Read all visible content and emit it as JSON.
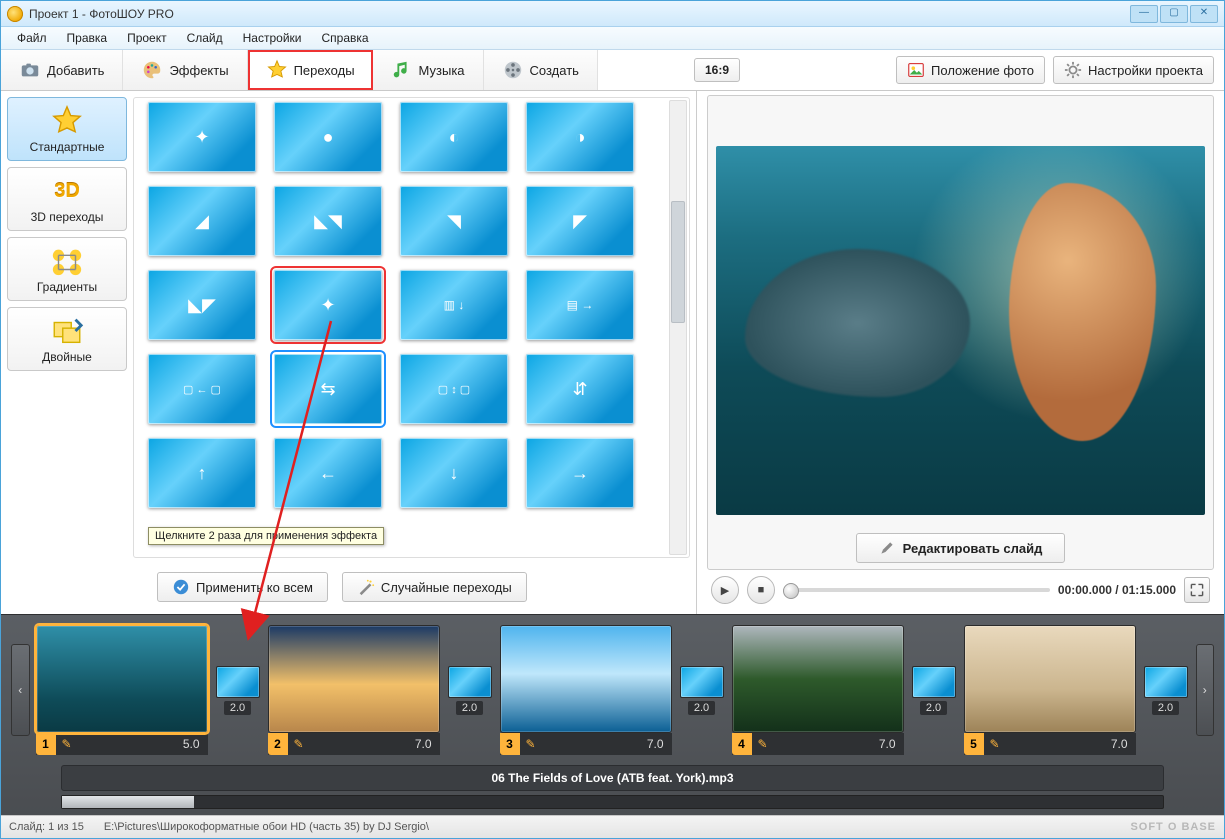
{
  "window": {
    "title": "Проект 1 - ФотоШОУ PRO"
  },
  "menu": {
    "items": [
      "Файл",
      "Правка",
      "Проект",
      "Слайд",
      "Настройки",
      "Справка"
    ]
  },
  "toolbar": {
    "tabs": [
      {
        "id": "add",
        "label": "Добавить"
      },
      {
        "id": "effects",
        "label": "Эффекты"
      },
      {
        "id": "transitions",
        "label": "Переходы"
      },
      {
        "id": "music",
        "label": "Музыка"
      },
      {
        "id": "create",
        "label": "Создать"
      }
    ],
    "active_tab": "transitions",
    "aspect": "16:9",
    "right": {
      "photo_position": "Положение фото",
      "project_settings": "Настройки проекта"
    }
  },
  "categories": {
    "items": [
      {
        "id": "standard",
        "label": "Стандартные"
      },
      {
        "id": "3d",
        "label": "3D переходы"
      },
      {
        "id": "gradients",
        "label": "Градиенты"
      },
      {
        "id": "double",
        "label": "Двойные"
      }
    ],
    "selected": "standard"
  },
  "gallery": {
    "tooltip": "Щелкните 2 раза для применения эффекта",
    "actions": {
      "apply_all": "Применить ко всем",
      "random": "Случайные переходы"
    }
  },
  "preview": {
    "edit_slide": "Редактировать слайд",
    "time_current": "00:00.000",
    "time_total": "01:15.000"
  },
  "timeline": {
    "slides": [
      {
        "n": "1",
        "dur": "5.0",
        "bg": "bg-dolphin",
        "active": true
      },
      {
        "n": "2",
        "dur": "7.0",
        "bg": "bg-pyramids"
      },
      {
        "n": "3",
        "dur": "7.0",
        "bg": "bg-ocean"
      },
      {
        "n": "4",
        "dur": "7.0",
        "bg": "bg-jungle"
      },
      {
        "n": "5",
        "dur": "7.0",
        "bg": "bg-fantasy"
      }
    ],
    "trans_dur": "2.0",
    "audio_track": "06 The Fields of Love (ATB feat. York).mp3"
  },
  "status": {
    "slide": "Слайд: 1 из 15",
    "path": "E:\\Pictures\\Широкоформатные обои HD (часть 35) by DJ Sergio\\",
    "brand": "SOFT O BASE"
  }
}
